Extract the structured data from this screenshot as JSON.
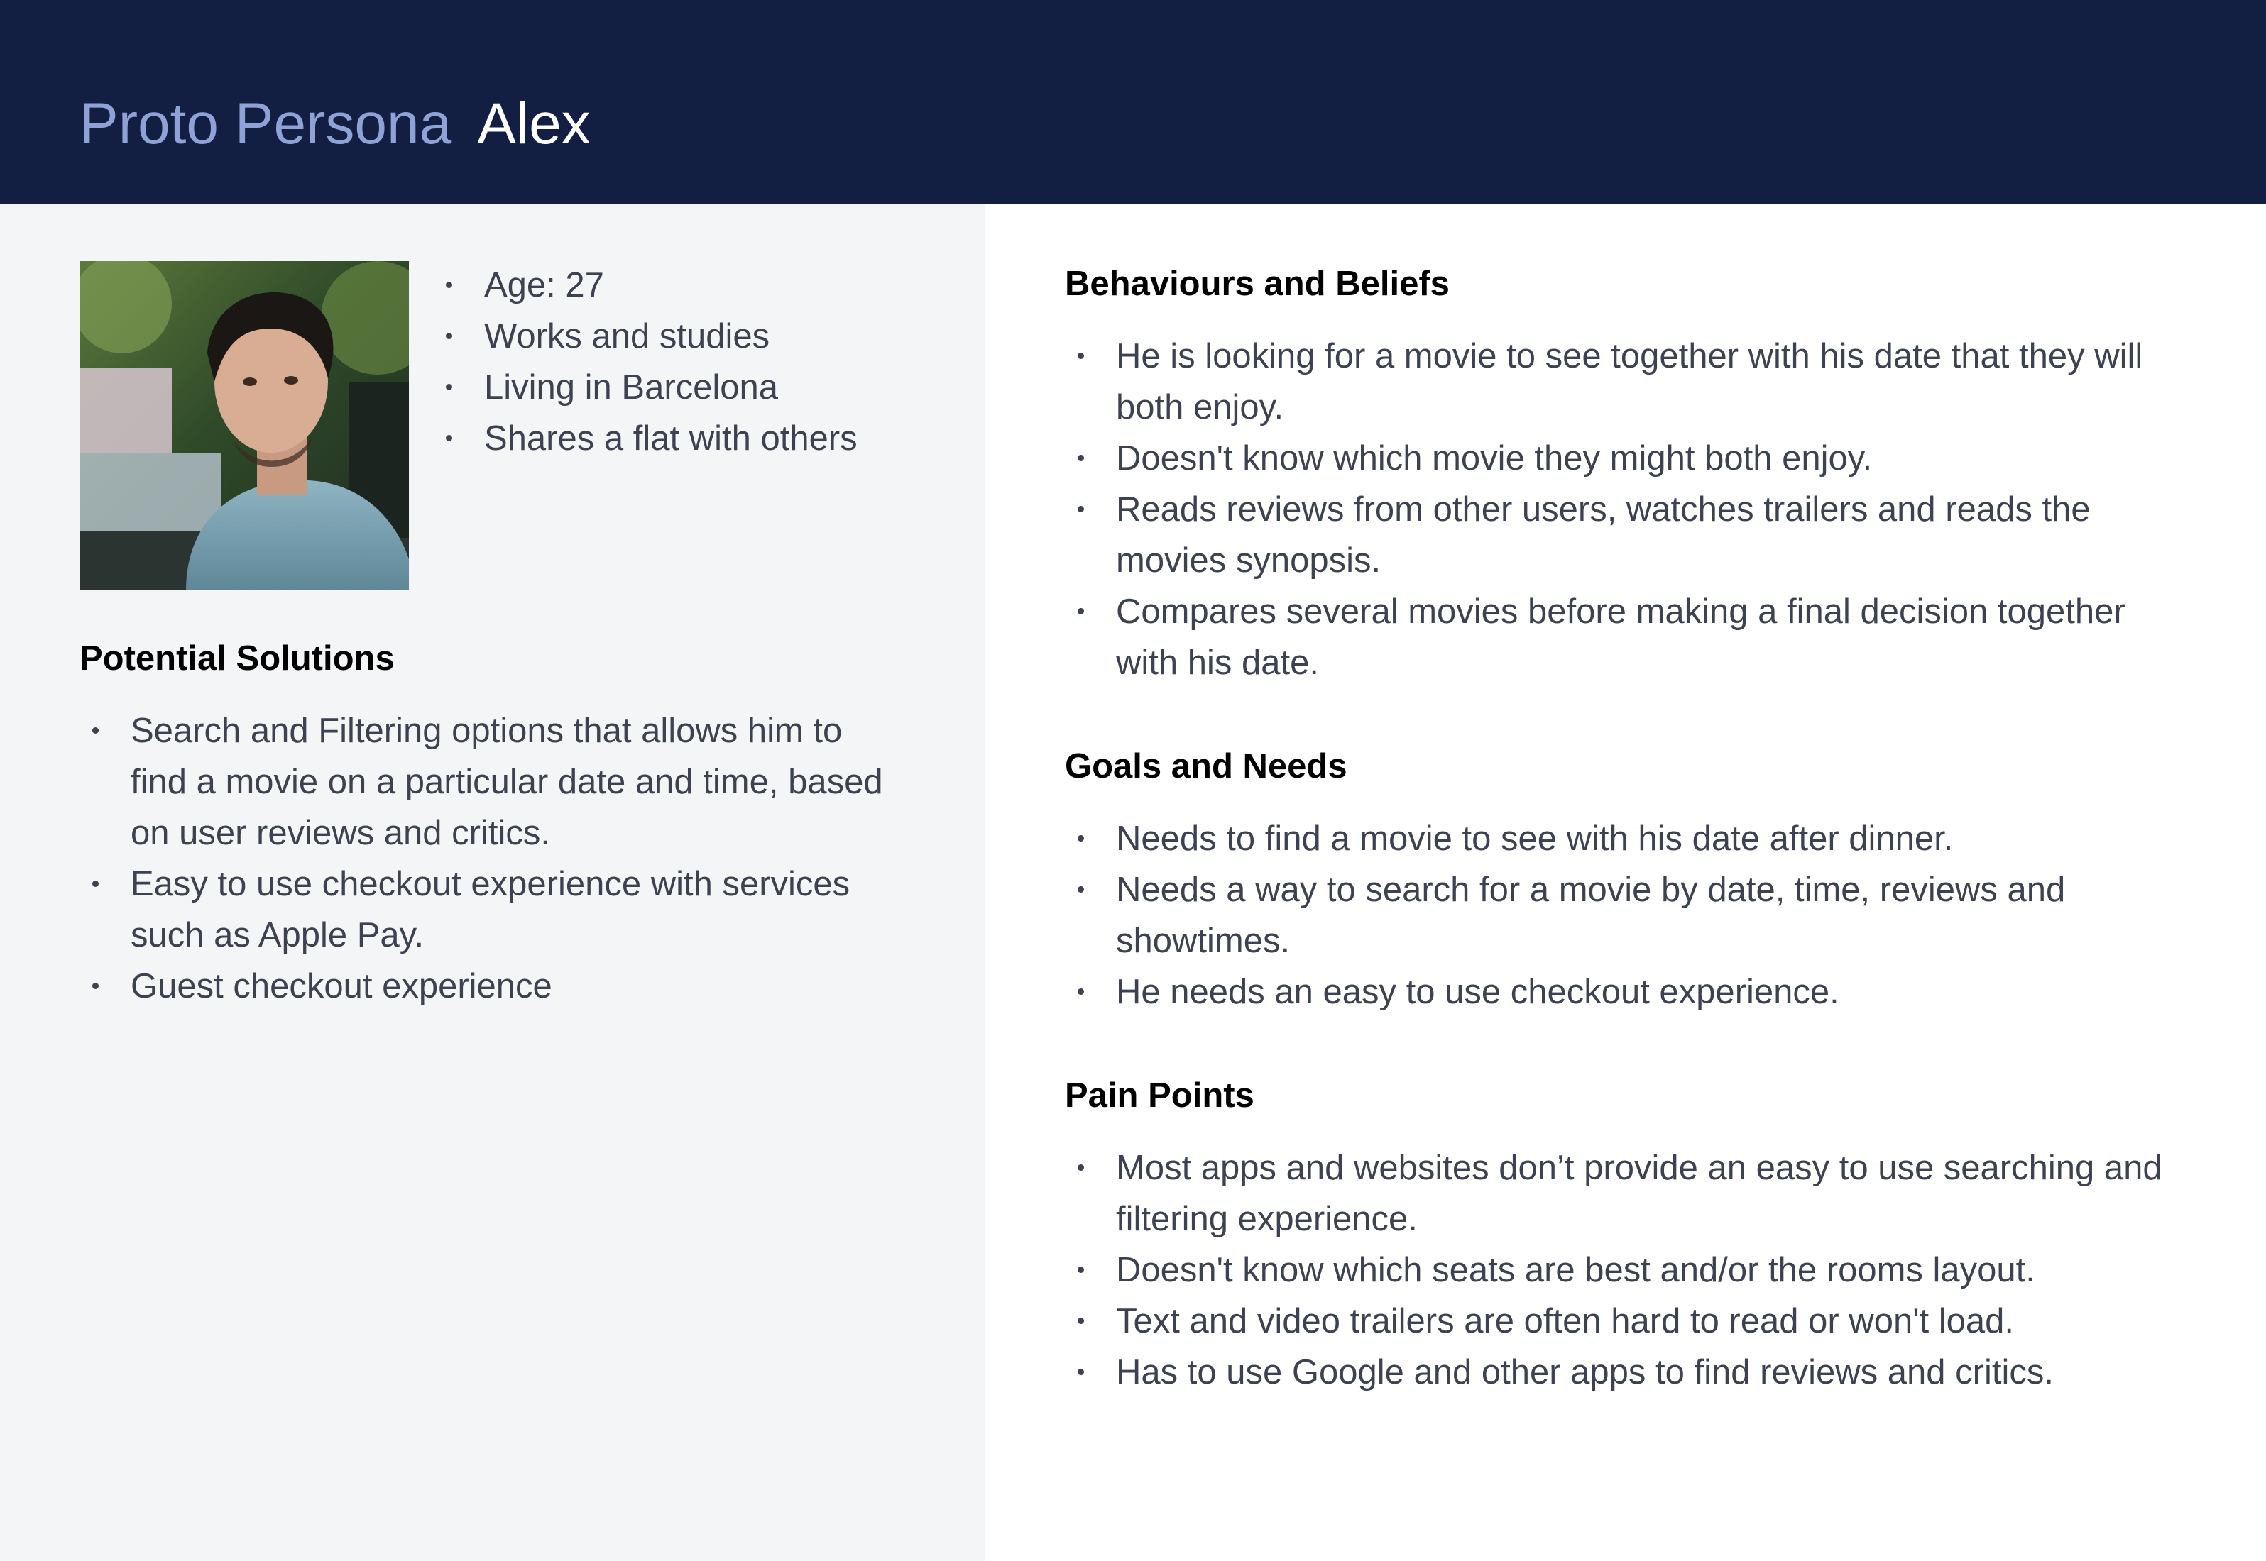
{
  "header": {
    "label": "Proto Persona",
    "name": "Alex"
  },
  "persona": {
    "photo_icon": "persona-photo",
    "facts": [
      "Age: 27",
      "Works and studies",
      "Living in Barcelona",
      "Shares a flat with others"
    ]
  },
  "potential_solutions": {
    "heading": "Potential Solutions",
    "items": [
      "Search and Filtering options that allows him to find a movie on a particular date and time, based on user reviews and critics.",
      "Easy to use checkout experience with services such as Apple Pay.",
      "Guest checkout experience"
    ]
  },
  "behaviours": {
    "heading": "Behaviours and Beliefs",
    "items": [
      "He is looking for a movie to see together with his date that they will both enjoy.",
      "Doesn't know which movie they might both enjoy.",
      "Reads reviews from other users, watches trailers and reads the movies synopsis.",
      "Compares several movies before making a final decision together with his date."
    ]
  },
  "goals": {
    "heading": "Goals and Needs",
    "items": [
      "Needs to find a movie to see with his date after dinner.",
      "Needs a way to search for a movie by date, time, reviews and showtimes.",
      "He needs an easy to use checkout experience."
    ]
  },
  "pain_points": {
    "heading": "Pain Points",
    "items": [
      "Most apps and websites don’t provide an easy to use searching and filtering experience.",
      "Doesn't know which seats are best and/or the rooms layout.",
      "Text and video trailers are often hard to read or won't load.",
      "Has to use Google and other apps to find reviews and critics."
    ]
  },
  "colors": {
    "header_bg": "#121f42",
    "title_label": "#8fa2d7",
    "left_panel_bg": "#f4f5f7",
    "body_text": "#3c4250"
  }
}
